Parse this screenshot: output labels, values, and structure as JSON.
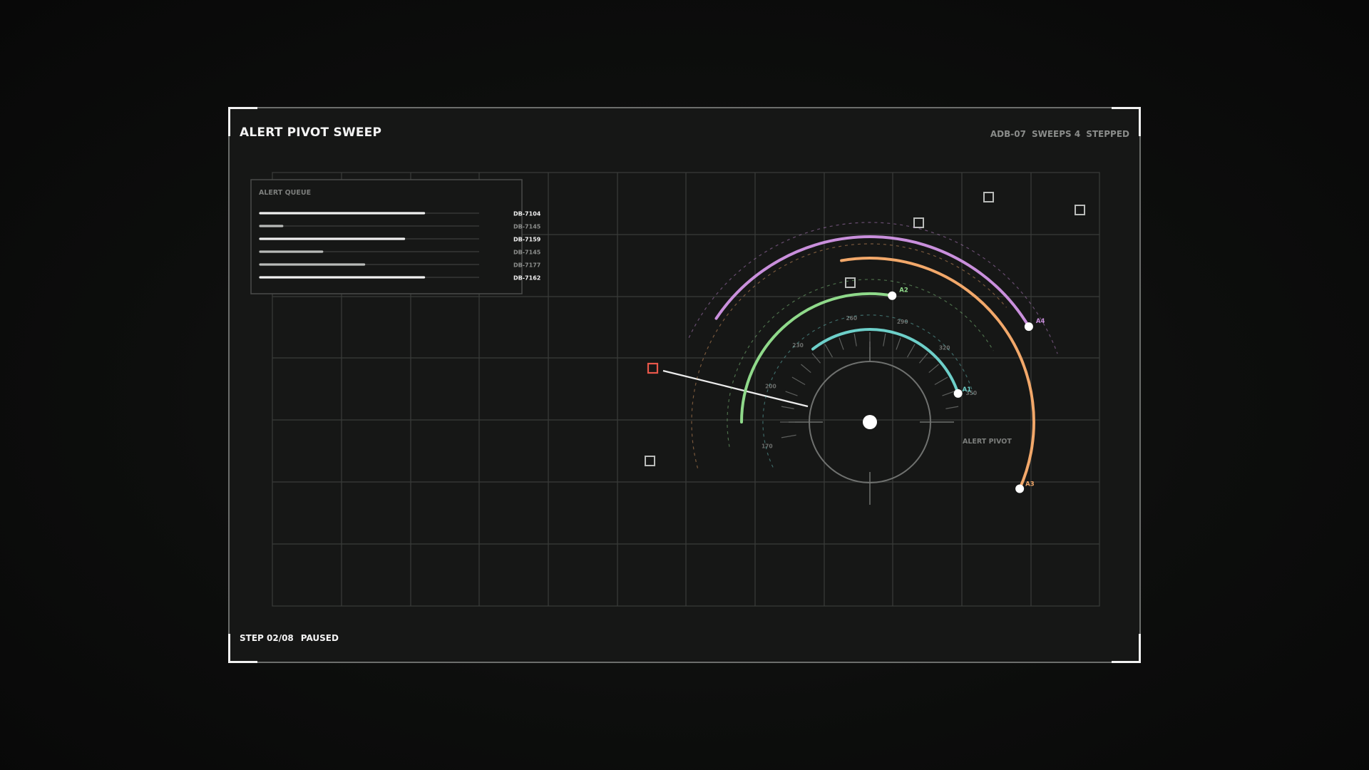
{
  "header": {
    "title": "ALERT PIVOT SWEEP",
    "device": "ADB-07",
    "sweeps": "SWEEPS 4",
    "mode": "STEPPED"
  },
  "footer": {
    "step": "STEP 02/08",
    "state": "PAUSED"
  },
  "queue": {
    "title": "ALERT QUEUE",
    "items": [
      {
        "id": "DB-7104",
        "level": 0.82,
        "highlight": true
      },
      {
        "id": "DB-7145",
        "level": 0.11,
        "highlight": false
      },
      {
        "id": "DB-7159",
        "level": 0.72,
        "highlight": true
      },
      {
        "id": "DB-7145",
        "level": 0.31,
        "highlight": false
      },
      {
        "id": "DB-7177",
        "level": 0.52,
        "highlight": false
      },
      {
        "id": "DB-7162",
        "level": 0.82,
        "highlight": true
      }
    ]
  },
  "dial": {
    "label": "ALERT PIVOT",
    "ticks": [
      "170",
      "200",
      "230",
      "260",
      "290",
      "320",
      "350"
    ]
  },
  "sweep_arcs": [
    {
      "id": "A1",
      "color": "#6dcfc9"
    },
    {
      "id": "A2",
      "color": "#8fd98a"
    },
    {
      "id": "A3",
      "color": "#f2a86a"
    },
    {
      "id": "A4",
      "color": "#c98fdc"
    }
  ],
  "colors": {
    "accent_alert": "#e8574a",
    "grid": "#3a3c3a",
    "marker": "#b9bbb9"
  }
}
